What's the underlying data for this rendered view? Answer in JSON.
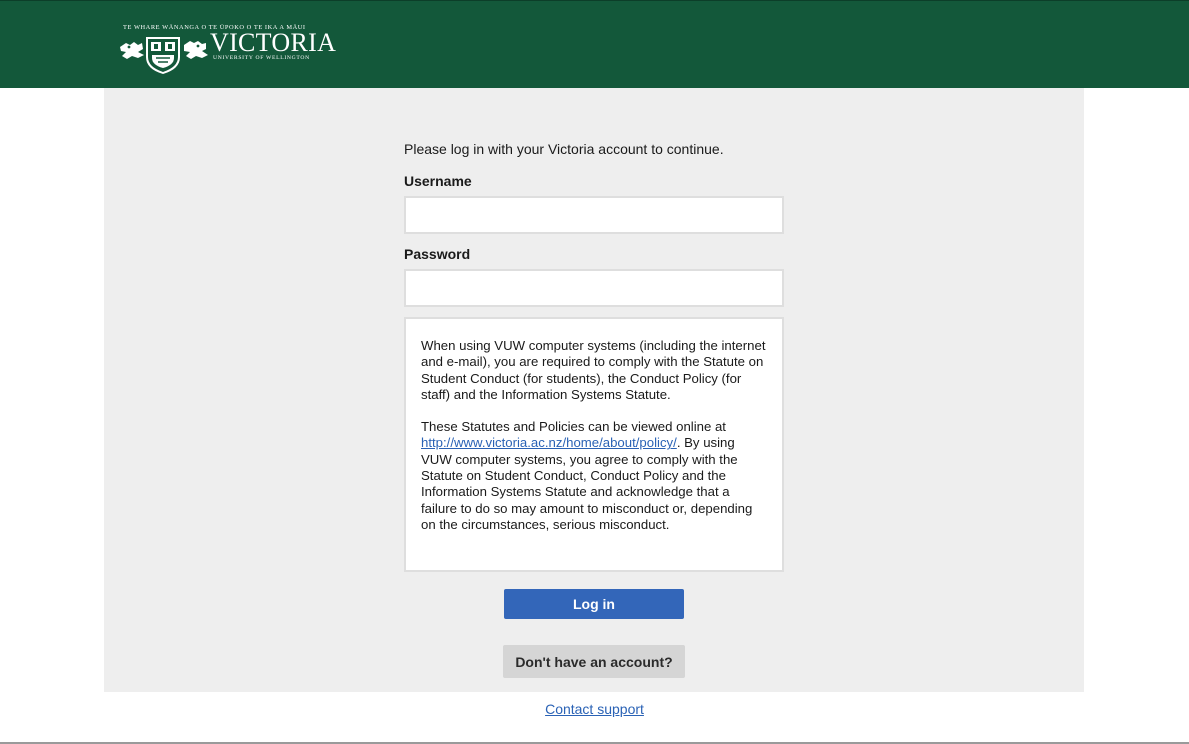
{
  "header": {
    "logo_tagline": "TE WHARE WĀNANGA O TE ŪPOKO O TE IKA A MĀUI",
    "logo_name": "VICTORIA",
    "logo_subtitle": "UNIVERSITY OF WELLINGTON",
    "logo_icon": "university-crest",
    "background_color": "#13583a"
  },
  "form": {
    "intro_text": "Please log in with your Victoria account to continue.",
    "username_label": "Username",
    "username_value": "",
    "password_label": "Password",
    "password_value": ""
  },
  "notice": {
    "paragraph1": "When using VUW computer systems (including the internet and e-mail), you are required to comply with the Statute on Student Conduct (for students), the Conduct Policy (for staff) and the Information Systems Statute.",
    "paragraph2_before": "These Statutes and Policies can be viewed online at ",
    "policy_link": "http://www.victoria.ac.nz/home/about/policy/",
    "paragraph2_after": ". By using VUW computer systems, you agree to comply with the Statute on Student Conduct, Conduct Policy and the Information Systems Statute and acknowledge that a failure to do so may amount to misconduct or, depending on the circumstances, serious misconduct."
  },
  "actions": {
    "login_label": "Log in",
    "login_color": "#3366b9",
    "no_account_label": "Don't have an account?"
  },
  "footer": {
    "support_link": "Contact support"
  }
}
